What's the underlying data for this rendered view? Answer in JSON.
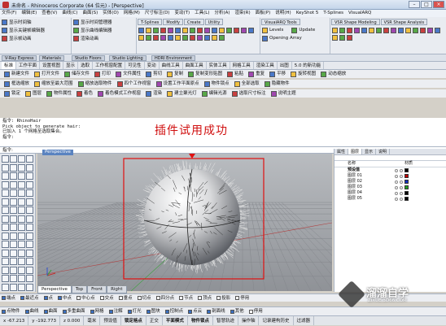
{
  "window": {
    "title": "未命名 - Rhinoceros Corporate (64 位元) - [Perspective]"
  },
  "menu": [
    "文件(F)",
    "编辑(E)",
    "查看(V)",
    "曲线(C)",
    "曲面(S)",
    "实体(O)",
    "网格(M)",
    "尺寸标注(D)",
    "变动(T)",
    "工具(L)",
    "分析(A)",
    "渲染(R)",
    "面板(P)",
    "说明(H)",
    "KeyShot 5",
    "T-Splines",
    "VisualARQ"
  ],
  "ribbon": {
    "g1": [
      "显示时间轴",
      "显示关键帧编辑器",
      "显示帧动画"
    ],
    "g2": [
      "显示时间管理器",
      "显示曲线编辑器",
      "渲染动画"
    ],
    "tabs": [
      "T-Splines",
      "Modify",
      "Create",
      "Utility",
      "Levels",
      "Update",
      "Opening Array",
      "VisualARQ Tools",
      "VSR Shape Modeling",
      "VSR Shape Analysis"
    ],
    "g3": [
      "Levels",
      "Update",
      "Opening Array"
    ]
  },
  "plugin_tabs": [
    "V-Ray Express",
    "Materials",
    "Studio Floors",
    "Studio Lighting",
    "HDRI Environment"
  ],
  "main_tabs": [
    "标准",
    "工作平面",
    "设置视图",
    "显示",
    "选取",
    "工作视窗配置",
    "可见性",
    "变动",
    "曲线工具",
    "曲面工具",
    "实体工具",
    "网格工具",
    "渲染工具",
    "出图",
    "5.0 的新功能"
  ],
  "toolbar1": [
    "新建文件",
    "打开文件",
    "储存文件",
    "打印",
    "文件属性",
    "剪切",
    "复制",
    "复制变形贴图",
    "粘贴",
    "重复",
    "平移",
    "旋转视图",
    "动态缩放"
  ],
  "toolbar2": [
    "框选缩放",
    "缩放至最大范围",
    "缩放选取物件",
    "四个工作视窗",
    "设置工作平面原点",
    "物件锁点",
    "全部选取",
    "隐藏物件"
  ],
  "toolbar3": [
    "锁定",
    "图层",
    "物件属性",
    "着色",
    "着色模式工作视窗",
    "渲染",
    "建立聚光灯",
    "编辑光源",
    "选取尺寸标注",
    "说明主题"
  ],
  "command": {
    "history": [
      "指令: RhinoHair",
      "Pick object to generate hair:",
      "已加入 1 个网格至选取集合。",
      "指令:"
    ],
    "prompt": "指令:"
  },
  "annotation": "插件试用成功",
  "viewport": {
    "name": "Perspective",
    "tabs": [
      "Perspective",
      "Top",
      "Front",
      "Right"
    ]
  },
  "right_panel": {
    "tabs": [
      "属性",
      "图层",
      "显示",
      "说明"
    ],
    "columns": [
      "名称",
      "材质"
    ],
    "layers": [
      {
        "name": "预设值",
        "color": "#000000",
        "current": true
      },
      {
        "name": "图层 01",
        "color": "#c00000"
      },
      {
        "name": "图层 02",
        "color": "#1030c0"
      },
      {
        "name": "图层 03",
        "color": "#20a020"
      },
      {
        "name": "图层 04",
        "color": "#000000"
      },
      {
        "name": "图层 05",
        "color": "#000000"
      }
    ]
  },
  "osnap_row1": [
    {
      "label": "端点",
      "on": true
    },
    {
      "label": "最近点",
      "on": true
    },
    {
      "label": "点",
      "on": true
    },
    {
      "label": "中点",
      "on": true
    },
    {
      "label": "中心点",
      "on": false
    },
    {
      "label": "交点",
      "on": false
    },
    {
      "label": "垂点",
      "on": false
    },
    {
      "label": "切点",
      "on": false
    },
    {
      "label": "四分点",
      "on": false
    },
    {
      "label": "节点",
      "on": false
    },
    {
      "label": "顶点",
      "on": false
    },
    {
      "label": "投影",
      "on": false
    },
    {
      "label": "停用",
      "on": false
    }
  ],
  "osnap_row2": [
    {
      "label": "点物件",
      "on": true
    },
    {
      "label": "曲线",
      "on": true
    },
    {
      "label": "曲面",
      "on": true
    },
    {
      "label": "多重曲面",
      "on": true
    },
    {
      "label": "网格",
      "on": true
    },
    {
      "label": "注解",
      "on": true
    },
    {
      "label": "灯光",
      "on": true
    },
    {
      "label": "图块",
      "on": true
    },
    {
      "label": "控制点",
      "on": true
    },
    {
      "label": "点云",
      "on": true
    },
    {
      "label": "剖面线",
      "on": true
    },
    {
      "label": "其他",
      "on": true
    },
    {
      "label": "停用",
      "on": false
    }
  ],
  "status": {
    "x": "x -67.213",
    "y": "y -192.773",
    "z": "z 0.000",
    "unit": "毫米",
    "layer": "预设值",
    "items": [
      "锁定格点",
      "正交",
      "平面模式",
      "物件锁点",
      "智慧轨迹",
      "操作轴",
      "记录建构历史",
      "过滤器"
    ]
  },
  "watermark": {
    "title": "溜溜自学",
    "sub": "ZIXUE.3D66.COM"
  }
}
